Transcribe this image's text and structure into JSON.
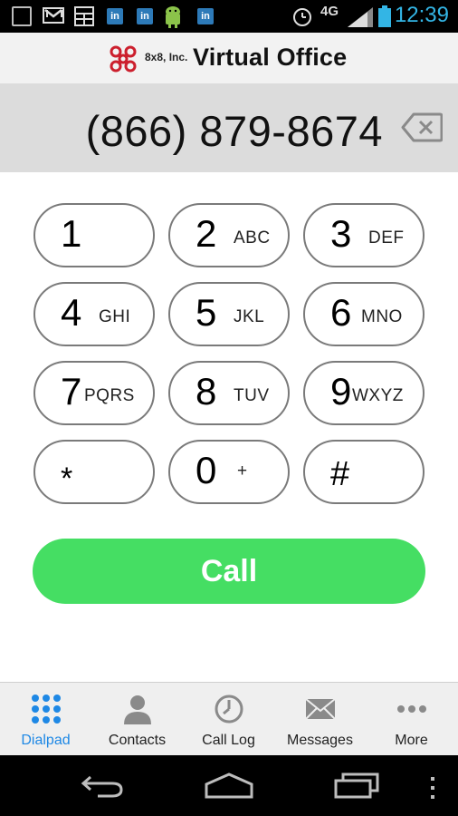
{
  "status_bar": {
    "time": "12:39",
    "network": "4G",
    "notification_icons": [
      "app-icon",
      "gmail-icon",
      "calculator-icon",
      "linkedin-icon",
      "linkedin-icon",
      "android-icon",
      "linkedin-icon"
    ],
    "accent_color": "#33b5e5"
  },
  "header": {
    "company": "8x8, Inc.",
    "product": "Virtual Office",
    "logo_color": "#cc1f2d"
  },
  "display": {
    "number": "(866) 879-8674"
  },
  "keypad": {
    "keys": [
      {
        "digit": "1",
        "letters": ""
      },
      {
        "digit": "2",
        "letters": "ABC"
      },
      {
        "digit": "3",
        "letters": "DEF"
      },
      {
        "digit": "4",
        "letters": "GHI"
      },
      {
        "digit": "5",
        "letters": "JKL"
      },
      {
        "digit": "6",
        "letters": "MNO"
      },
      {
        "digit": "7",
        "letters": "PQRS"
      },
      {
        "digit": "8",
        "letters": "TUV"
      },
      {
        "digit": "9",
        "letters": "WXYZ"
      },
      {
        "digit": "*",
        "letters": ""
      },
      {
        "digit": "0",
        "letters": "+"
      },
      {
        "digit": "#",
        "letters": ""
      }
    ]
  },
  "call": {
    "label": "Call",
    "color": "#45de63"
  },
  "tabs": [
    {
      "label": "Dialpad",
      "icon": "dialpad-icon",
      "active": true
    },
    {
      "label": "Contacts",
      "icon": "contact-icon",
      "active": false
    },
    {
      "label": "Call Log",
      "icon": "clock-icon",
      "active": false
    },
    {
      "label": "Messages",
      "icon": "envelope-icon",
      "active": false
    },
    {
      "label": "More",
      "icon": "more-dots-icon",
      "active": false
    }
  ],
  "colors": {
    "active_tab": "#1e88e5"
  }
}
